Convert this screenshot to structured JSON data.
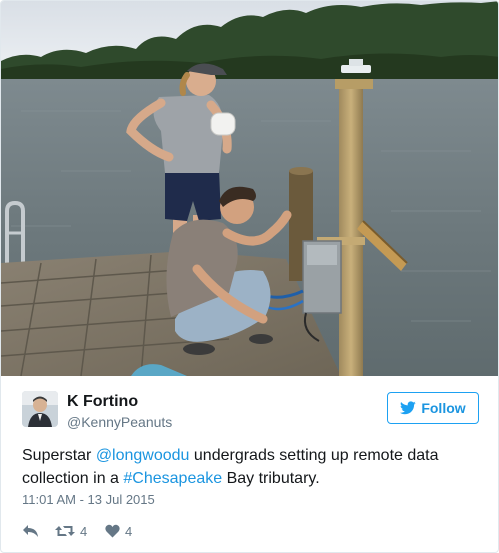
{
  "photo": {
    "alt": "Two students setting up equipment on a wooden dock by the water"
  },
  "user": {
    "display_name": "K Fortino",
    "screen_name": "@KennyPeanuts",
    "avatar_icon": "user-avatar"
  },
  "follow": {
    "label": "Follow",
    "icon": "twitter-bird-icon",
    "color": "#1da1f2"
  },
  "tweet": {
    "text_1": "Superstar ",
    "mention": "@longwoodu",
    "text_2": " undergrads setting up remote data collection in a ",
    "hashtag": "#Chesapeake",
    "text_3": " Bay tributary.",
    "link_color": "#1b95e0"
  },
  "timestamp": "11:01 AM - 13 Jul 2015",
  "actions": {
    "reply_icon": "reply-icon",
    "retweet_icon": "retweet-icon",
    "retweet_count": "4",
    "like_icon": "heart-icon",
    "like_count": "4"
  }
}
